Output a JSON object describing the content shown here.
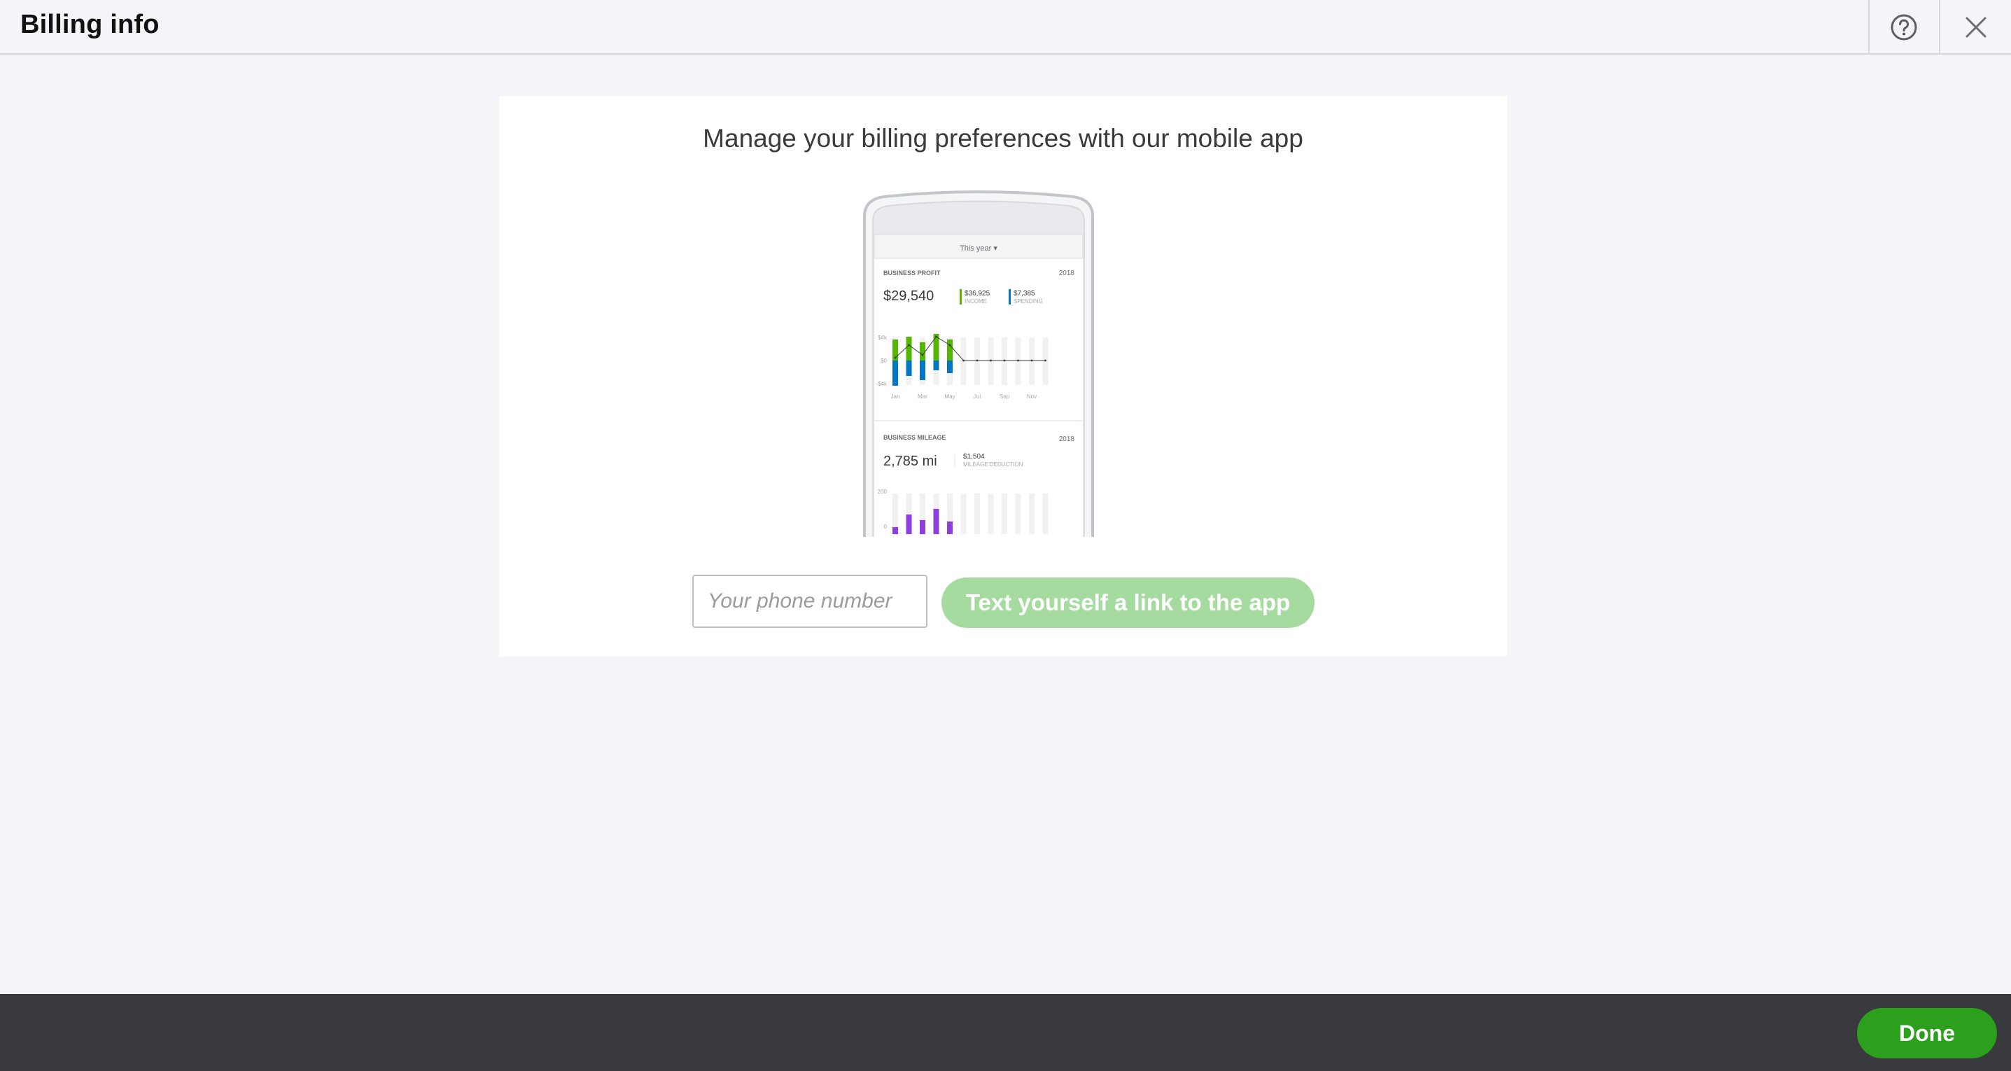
{
  "header": {
    "title": "Billing info",
    "help_icon": "help-circle-icon",
    "close_icon": "close-icon"
  },
  "card": {
    "headline": "Manage your billing preferences with our mobile app",
    "phone_input": {
      "placeholder": "Your phone number",
      "value": ""
    },
    "text_link_button": "Text yourself a link to the app"
  },
  "phone_preview": {
    "period_selector": "This year ▾",
    "profit": {
      "label": "BUSINESS PROFIT",
      "year": "2018",
      "amount": "$29,540",
      "income_amount": "$36,925",
      "income_label": "INCOME",
      "spending_amount": "$7,385",
      "spending_label": "SPENDING",
      "y_ticks": [
        "$4k",
        "$0",
        "-$4k"
      ],
      "months": [
        "Jan",
        "Mar",
        "May",
        "Jul",
        "Sep",
        "Nov"
      ]
    },
    "mileage": {
      "label": "BUSINESS MILEAGE",
      "year": "2018",
      "amount": "2,785 mi",
      "deduction_amount": "$1,504",
      "deduction_label": "MILEAGE DEDUCTION",
      "y_ticks": [
        "200",
        "0"
      ]
    },
    "colors": {
      "income": "#53b700",
      "spending": "#0077c5",
      "mileage": "#8d3ee0"
    }
  },
  "footer": {
    "done_label": "Done"
  },
  "colors": {
    "primary_green": "#2ca01c",
    "disabled_green": "#a6dba0",
    "footer_bg": "#393a3d",
    "page_bg": "#f3f5f8"
  }
}
